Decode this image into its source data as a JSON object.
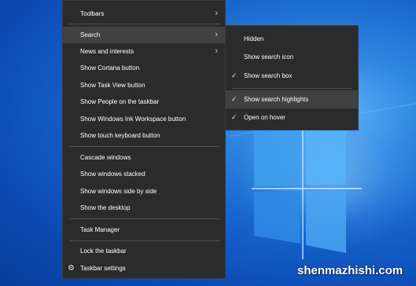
{
  "main_menu": {
    "items": [
      {
        "label": "Toolbars",
        "has_submenu": true
      },
      {
        "label": "Search",
        "has_submenu": true,
        "highlighted": true
      },
      {
        "label": "News and interests",
        "has_submenu": true
      },
      {
        "label": "Show Cortana button"
      },
      {
        "label": "Show Task View button"
      },
      {
        "label": "Show People on the taskbar"
      },
      {
        "label": "Show Windows Ink Workspace button"
      },
      {
        "label": "Show touch keyboard button"
      },
      {
        "label": "Cascade windows"
      },
      {
        "label": "Show windows stacked"
      },
      {
        "label": "Show windows side by side"
      },
      {
        "label": "Show the desktop"
      },
      {
        "label": "Task Manager"
      },
      {
        "label": "Lock the taskbar"
      },
      {
        "label": "Taskbar settings",
        "icon": "gear-icon"
      }
    ]
  },
  "search_submenu": {
    "items": [
      {
        "label": "Hidden",
        "checked": false
      },
      {
        "label": "Show search icon",
        "checked": false
      },
      {
        "label": "Show search box",
        "checked": true
      },
      {
        "label": "Show search highlights",
        "checked": true,
        "highlighted": true
      },
      {
        "label": "Open on hover",
        "checked": true
      }
    ]
  },
  "glyphs": {
    "arrow": "›",
    "check": "✓",
    "gear": "⚙"
  },
  "watermark": {
    "text": "shenmazhishi.com"
  },
  "colors": {
    "menu_bg": "#2b2b2b",
    "menu_hover": "#414141",
    "desktop_blue": "#1764cc"
  }
}
